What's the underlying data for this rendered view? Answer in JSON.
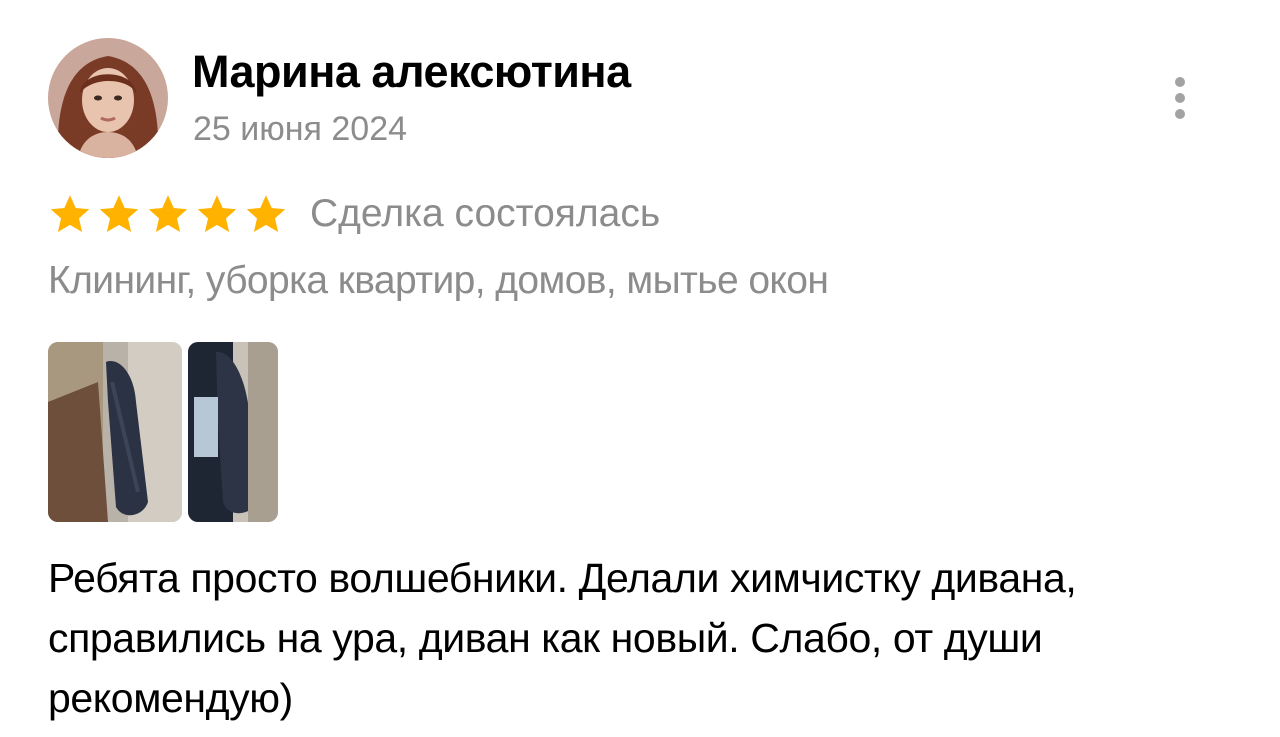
{
  "review": {
    "author": {
      "name": "Марина алексютина",
      "avatar_icon": "user-photo-avatar"
    },
    "date": "25 июня 2024",
    "more_icon": "vertical-dots-icon",
    "rating": {
      "value": 5,
      "max": 5,
      "star_color": "#ffb300"
    },
    "deal_status": "Сделка состоялась",
    "service": "Клининг, уборка квартир, домов, мытье окон",
    "photos": [
      {
        "alt": "sofa-before-photo"
      },
      {
        "alt": "sofa-after-photo"
      }
    ],
    "text": "Ребята просто волшебники. Делали химчистку дивана, справились на ура, диван как новый. Слабо, от души рекомендую)"
  }
}
